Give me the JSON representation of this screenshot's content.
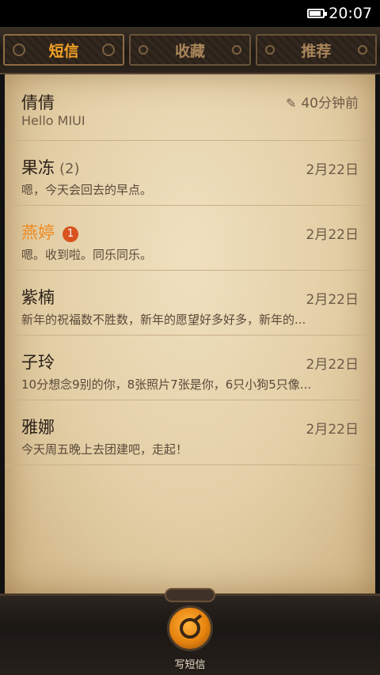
{
  "status_bar": {
    "time": "20:07"
  },
  "tabs": [
    {
      "label": "短信",
      "active": true
    },
    {
      "label": "收藏",
      "active": false
    },
    {
      "label": "推荐",
      "active": false
    }
  ],
  "conversations": [
    {
      "name": "倩倩",
      "count": "",
      "badge": "",
      "date": "40分钟前",
      "draft": true,
      "preview": "Hello MIUI"
    },
    {
      "name": "果冻",
      "count": "(2)",
      "badge": "",
      "date": "2月22日",
      "draft": false,
      "preview": "嗯，今天会回去的早点。"
    },
    {
      "name": "燕婷",
      "count": "",
      "badge": "1",
      "date": "2月22日",
      "draft": false,
      "preview": "嗯。收到啦。同乐同乐。"
    },
    {
      "name": "紫楠",
      "count": "",
      "badge": "",
      "date": "2月22日",
      "draft": false,
      "preview": "新年的祝福数不胜数，新年的愿望好多好多，新年的..."
    },
    {
      "name": "子玲",
      "count": "",
      "badge": "",
      "date": "2月22日",
      "draft": false,
      "preview": "10分想念9别的你，8张照片7张是你，6只小狗5只像..."
    },
    {
      "name": "雅娜",
      "count": "",
      "badge": "",
      "date": "2月22日",
      "draft": false,
      "preview": "今天周五晚上去团建吧，走起！"
    }
  ],
  "compose": {
    "label": "写短信"
  },
  "colors": {
    "accent": "#f2a226",
    "unread_name": "#ef8a1f",
    "badge": "#d9531e"
  }
}
